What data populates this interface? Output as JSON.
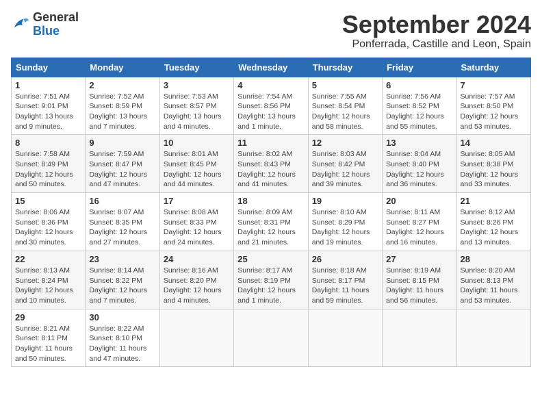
{
  "logo": {
    "general": "General",
    "blue": "Blue"
  },
  "header": {
    "month": "September 2024",
    "location": "Ponferrada, Castille and Leon, Spain"
  },
  "weekdays": [
    "Sunday",
    "Monday",
    "Tuesday",
    "Wednesday",
    "Thursday",
    "Friday",
    "Saturday"
  ],
  "weeks": [
    [
      {
        "day": "1",
        "sunrise": "Sunrise: 7:51 AM",
        "sunset": "Sunset: 9:01 PM",
        "daylight": "Daylight: 13 hours and 9 minutes."
      },
      {
        "day": "2",
        "sunrise": "Sunrise: 7:52 AM",
        "sunset": "Sunset: 8:59 PM",
        "daylight": "Daylight: 13 hours and 7 minutes."
      },
      {
        "day": "3",
        "sunrise": "Sunrise: 7:53 AM",
        "sunset": "Sunset: 8:57 PM",
        "daylight": "Daylight: 13 hours and 4 minutes."
      },
      {
        "day": "4",
        "sunrise": "Sunrise: 7:54 AM",
        "sunset": "Sunset: 8:56 PM",
        "daylight": "Daylight: 13 hours and 1 minute."
      },
      {
        "day": "5",
        "sunrise": "Sunrise: 7:55 AM",
        "sunset": "Sunset: 8:54 PM",
        "daylight": "Daylight: 12 hours and 58 minutes."
      },
      {
        "day": "6",
        "sunrise": "Sunrise: 7:56 AM",
        "sunset": "Sunset: 8:52 PM",
        "daylight": "Daylight: 12 hours and 55 minutes."
      },
      {
        "day": "7",
        "sunrise": "Sunrise: 7:57 AM",
        "sunset": "Sunset: 8:50 PM",
        "daylight": "Daylight: 12 hours and 53 minutes."
      }
    ],
    [
      {
        "day": "8",
        "sunrise": "Sunrise: 7:58 AM",
        "sunset": "Sunset: 8:49 PM",
        "daylight": "Daylight: 12 hours and 50 minutes."
      },
      {
        "day": "9",
        "sunrise": "Sunrise: 7:59 AM",
        "sunset": "Sunset: 8:47 PM",
        "daylight": "Daylight: 12 hours and 47 minutes."
      },
      {
        "day": "10",
        "sunrise": "Sunrise: 8:01 AM",
        "sunset": "Sunset: 8:45 PM",
        "daylight": "Daylight: 12 hours and 44 minutes."
      },
      {
        "day": "11",
        "sunrise": "Sunrise: 8:02 AM",
        "sunset": "Sunset: 8:43 PM",
        "daylight": "Daylight: 12 hours and 41 minutes."
      },
      {
        "day": "12",
        "sunrise": "Sunrise: 8:03 AM",
        "sunset": "Sunset: 8:42 PM",
        "daylight": "Daylight: 12 hours and 39 minutes."
      },
      {
        "day": "13",
        "sunrise": "Sunrise: 8:04 AM",
        "sunset": "Sunset: 8:40 PM",
        "daylight": "Daylight: 12 hours and 36 minutes."
      },
      {
        "day": "14",
        "sunrise": "Sunrise: 8:05 AM",
        "sunset": "Sunset: 8:38 PM",
        "daylight": "Daylight: 12 hours and 33 minutes."
      }
    ],
    [
      {
        "day": "15",
        "sunrise": "Sunrise: 8:06 AM",
        "sunset": "Sunset: 8:36 PM",
        "daylight": "Daylight: 12 hours and 30 minutes."
      },
      {
        "day": "16",
        "sunrise": "Sunrise: 8:07 AM",
        "sunset": "Sunset: 8:35 PM",
        "daylight": "Daylight: 12 hours and 27 minutes."
      },
      {
        "day": "17",
        "sunrise": "Sunrise: 8:08 AM",
        "sunset": "Sunset: 8:33 PM",
        "daylight": "Daylight: 12 hours and 24 minutes."
      },
      {
        "day": "18",
        "sunrise": "Sunrise: 8:09 AM",
        "sunset": "Sunset: 8:31 PM",
        "daylight": "Daylight: 12 hours and 21 minutes."
      },
      {
        "day": "19",
        "sunrise": "Sunrise: 8:10 AM",
        "sunset": "Sunset: 8:29 PM",
        "daylight": "Daylight: 12 hours and 19 minutes."
      },
      {
        "day": "20",
        "sunrise": "Sunrise: 8:11 AM",
        "sunset": "Sunset: 8:27 PM",
        "daylight": "Daylight: 12 hours and 16 minutes."
      },
      {
        "day": "21",
        "sunrise": "Sunrise: 8:12 AM",
        "sunset": "Sunset: 8:26 PM",
        "daylight": "Daylight: 12 hours and 13 minutes."
      }
    ],
    [
      {
        "day": "22",
        "sunrise": "Sunrise: 8:13 AM",
        "sunset": "Sunset: 8:24 PM",
        "daylight": "Daylight: 12 hours and 10 minutes."
      },
      {
        "day": "23",
        "sunrise": "Sunrise: 8:14 AM",
        "sunset": "Sunset: 8:22 PM",
        "daylight": "Daylight: 12 hours and 7 minutes."
      },
      {
        "day": "24",
        "sunrise": "Sunrise: 8:16 AM",
        "sunset": "Sunset: 8:20 PM",
        "daylight": "Daylight: 12 hours and 4 minutes."
      },
      {
        "day": "25",
        "sunrise": "Sunrise: 8:17 AM",
        "sunset": "Sunset: 8:19 PM",
        "daylight": "Daylight: 12 hours and 1 minute."
      },
      {
        "day": "26",
        "sunrise": "Sunrise: 8:18 AM",
        "sunset": "Sunset: 8:17 PM",
        "daylight": "Daylight: 11 hours and 59 minutes."
      },
      {
        "day": "27",
        "sunrise": "Sunrise: 8:19 AM",
        "sunset": "Sunset: 8:15 PM",
        "daylight": "Daylight: 11 hours and 56 minutes."
      },
      {
        "day": "28",
        "sunrise": "Sunrise: 8:20 AM",
        "sunset": "Sunset: 8:13 PM",
        "daylight": "Daylight: 11 hours and 53 minutes."
      }
    ],
    [
      {
        "day": "29",
        "sunrise": "Sunrise: 8:21 AM",
        "sunset": "Sunset: 8:11 PM",
        "daylight": "Daylight: 11 hours and 50 minutes."
      },
      {
        "day": "30",
        "sunrise": "Sunrise: 8:22 AM",
        "sunset": "Sunset: 8:10 PM",
        "daylight": "Daylight: 11 hours and 47 minutes."
      },
      null,
      null,
      null,
      null,
      null
    ]
  ]
}
